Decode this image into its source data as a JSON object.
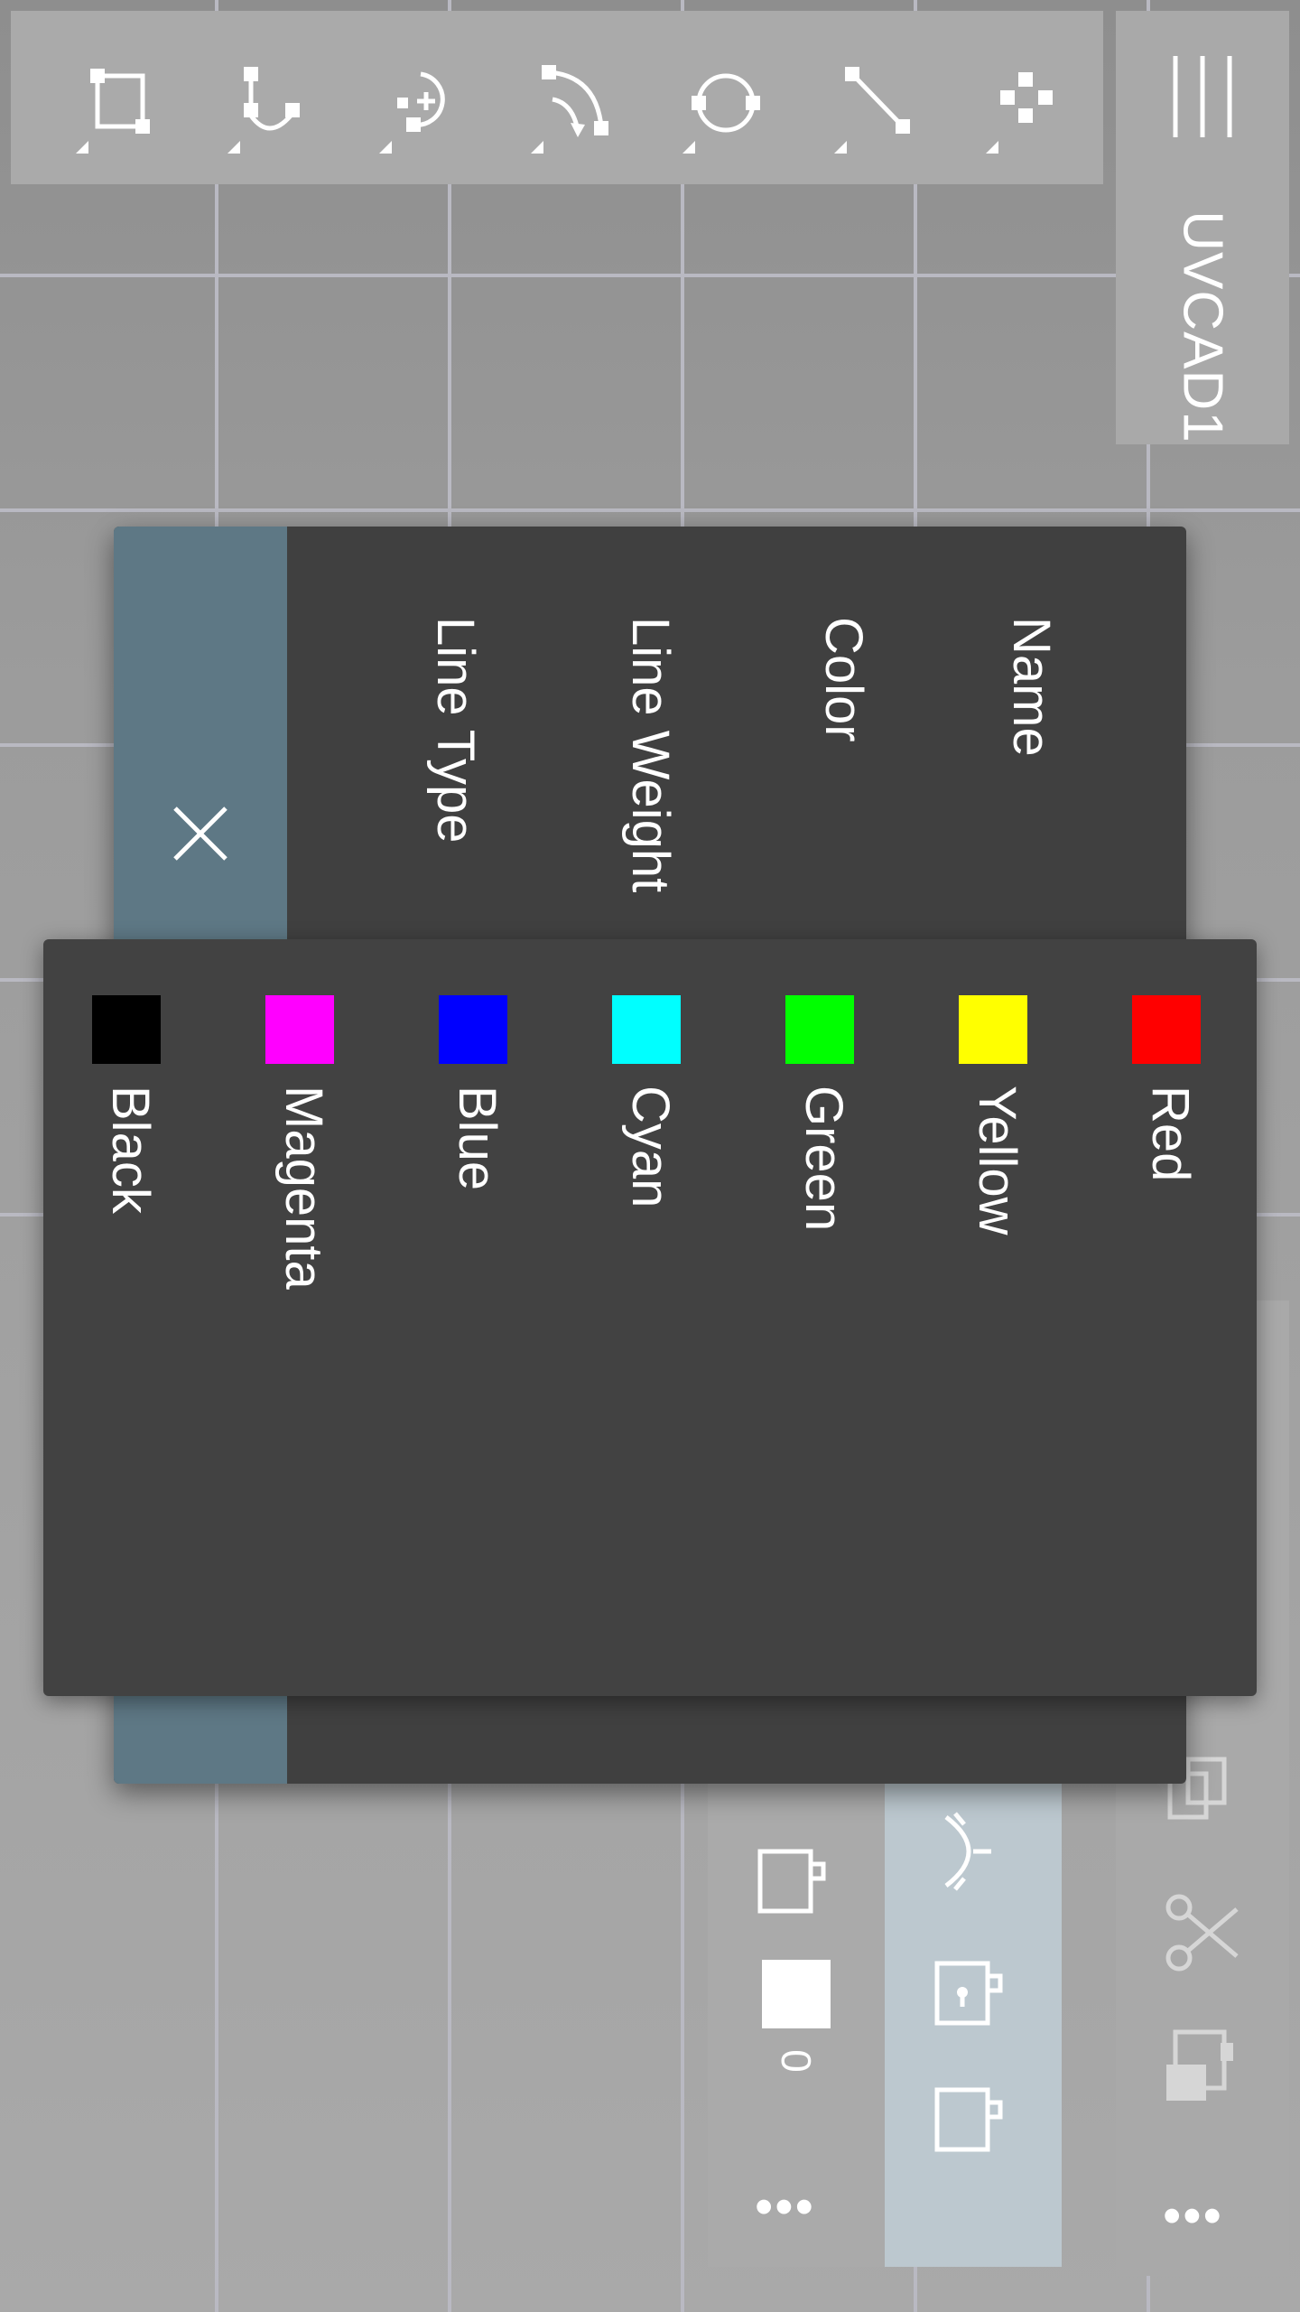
{
  "app": {
    "document_title": "UVCAD1"
  },
  "toolbar": {
    "tools": [
      {
        "icon": "rectangle-crop-icon"
      },
      {
        "icon": "trim-curve-icon"
      },
      {
        "icon": "add-point-icon"
      },
      {
        "icon": "rotate-arc-icon"
      },
      {
        "icon": "circle-icon"
      },
      {
        "icon": "line-icon"
      },
      {
        "icon": "points-grid-icon"
      }
    ]
  },
  "layer_dialog": {
    "fields": {
      "name": "Name",
      "color": "Color",
      "line_weight": "Line Weight",
      "line_type": "Line Type"
    }
  },
  "color_picker": {
    "options": [
      {
        "label": "Red",
        "color": "#ff0000"
      },
      {
        "label": "Yellow",
        "color": "#ffff00"
      },
      {
        "label": "Green",
        "color": "#00ff00"
      },
      {
        "label": "Cyan",
        "color": "#00ffff"
      },
      {
        "label": "Blue",
        "color": "#0000ff"
      },
      {
        "label": "Magenta",
        "color": "#ff00ff"
      },
      {
        "label": "Black",
        "color": "#000000"
      }
    ]
  },
  "layer_panel": {
    "layer_number": "0",
    "more": "•••"
  },
  "side_panel": {
    "more": "•••"
  },
  "colors": {
    "dialog_bg": "#404040",
    "dialog_side": "#5e7885",
    "picker_bg": "#424242"
  }
}
